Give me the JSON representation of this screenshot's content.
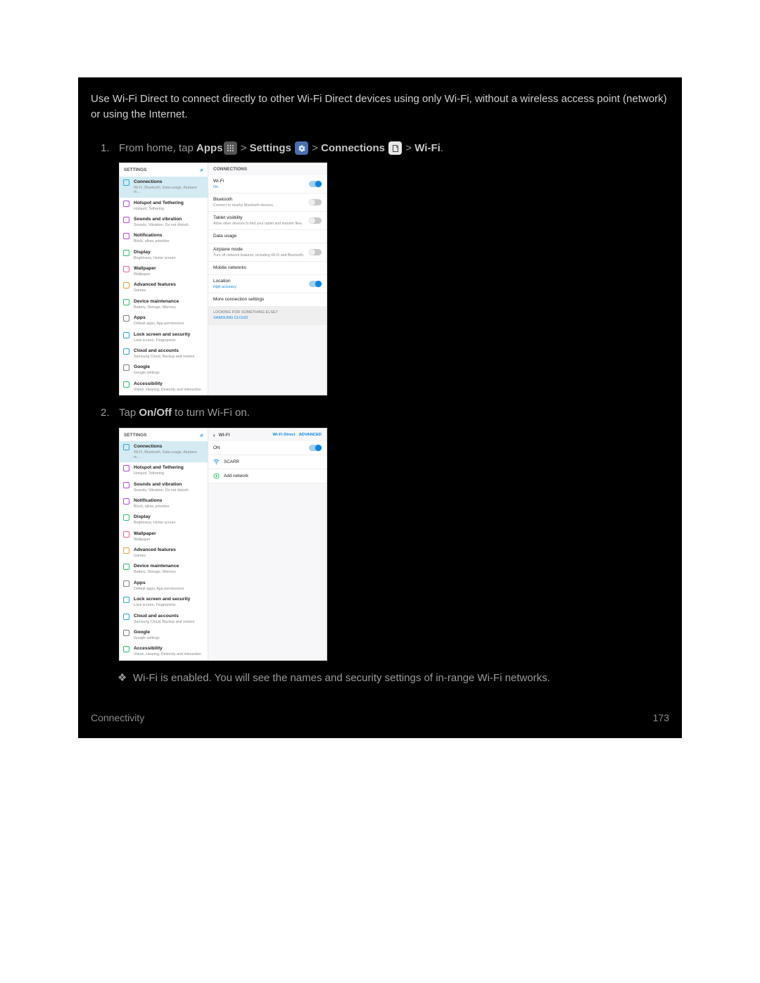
{
  "intro": "Use Wi-Fi Direct to connect directly to other Wi-Fi Direct devices using only Wi-Fi, without a wireless access point (network) or using the Internet.",
  "step1": {
    "num": "1.",
    "lead": "From home, tap ",
    "apps": "Apps",
    "gt1": " > ",
    "settings": "Settings",
    "gt2": " > ",
    "connections": "Connections",
    "gt3": " > ",
    "wifi": "Wi-Fi",
    "end": "."
  },
  "step2": {
    "num": "2.",
    "pre": "Tap ",
    "onoff": "On/Off",
    "post": " to turn Wi-Fi on."
  },
  "bullet": "Wi-Fi is enabled. You will see the names and security settings of in-range Wi-Fi networks.",
  "footer": {
    "left": "Connectivity",
    "right": "173"
  },
  "shot_common": {
    "settings_label": "SETTINGS",
    "conn_label": "CONNECTIONS",
    "left_items": [
      {
        "t": "Connections",
        "s": "Wi-Fi, Bluetooth, Data usage, Airplane m…",
        "c": "#2aa6d0",
        "sel": true
      },
      {
        "t": "Hotspot and Tethering",
        "s": "Hotspot, Tethering",
        "c": "#b04ad6"
      },
      {
        "t": "Sounds and vibration",
        "s": "Sounds, Vibration, Do not disturb",
        "c": "#b04ad6"
      },
      {
        "t": "Notifications",
        "s": "Block, allow, prioritize",
        "c": "#b04ad6"
      },
      {
        "t": "Display",
        "s": "Brightness, Home screen",
        "c": "#2bbf6a"
      },
      {
        "t": "Wallpaper",
        "s": "Wallpaper",
        "c": "#e85fa1"
      },
      {
        "t": "Advanced features",
        "s": "Games",
        "c": "#e6a13a"
      },
      {
        "t": "Device maintenance",
        "s": "Battery, Storage, Memory",
        "c": "#2bbf6a"
      },
      {
        "t": "Apps",
        "s": "Default apps, App permissions",
        "c": "#7d7d7d"
      },
      {
        "t": "Lock screen and security",
        "s": "Lock screen, Fingerprints",
        "c": "#2aa6d0"
      },
      {
        "t": "Cloud and accounts",
        "s": "Samsung Cloud, Backup and restore",
        "c": "#2aa6d0"
      },
      {
        "t": "Google",
        "s": "Google settings",
        "c": "#7d7d7d"
      },
      {
        "t": "Accessibility",
        "s": "Vision, Hearing, Dexterity and interaction",
        "c": "#2bbf6a"
      }
    ]
  },
  "shot1_right": [
    {
      "t": "Wi-Fi",
      "s": "On",
      "on": true,
      "toggle": "on"
    },
    {
      "t": "Bluetooth",
      "s": "Connect to nearby Bluetooth devices.",
      "toggle": "off"
    },
    {
      "t": "Tablet visibility",
      "s": "Allow other devices to find your tablet and transfer files.",
      "toggle": "off"
    },
    {
      "t": "Data usage"
    },
    {
      "t": "Airplane mode",
      "s": "Turn off network features, including Wi-Fi and Bluetooth.",
      "toggle": "off"
    },
    {
      "t": "Mobile networks"
    },
    {
      "t": "Location",
      "s": "High accuracy",
      "on": true,
      "toggle": "on"
    },
    {
      "t": "More connection settings"
    }
  ],
  "shot1_note": {
    "t": "LOOKING FOR SOMETHING ELSE?",
    "l": "SAMSUNG CLOUD"
  },
  "shot2_header": {
    "back": "‹",
    "title": "WI-FI",
    "direct": "Wi-Fi Direct",
    "adv": "ADVANCED"
  },
  "shot2_on": {
    "t": "ON",
    "toggle": "on"
  },
  "shot2_nets": [
    {
      "name": "SCARR",
      "type": "wifi"
    },
    {
      "name": "Add network",
      "type": "add"
    }
  ]
}
